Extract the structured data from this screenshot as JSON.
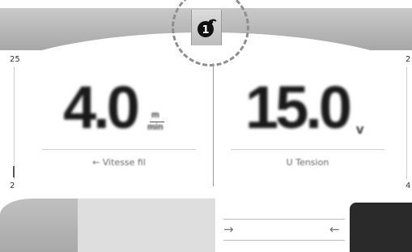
{
  "header": {
    "mode_badge": "1"
  },
  "left_gauge": {
    "scale_max": "25",
    "scale_min": "2",
    "value": "4.0",
    "unit_top": "m",
    "unit_bottom": "min",
    "label": "← Vitesse fil"
  },
  "right_gauge": {
    "scale_max": "2",
    "scale_min": "4",
    "value": "15.0",
    "unit": "V",
    "label": "U Tension"
  },
  "bottom": {
    "arrow_right": "→",
    "arrow_left": "←"
  }
}
